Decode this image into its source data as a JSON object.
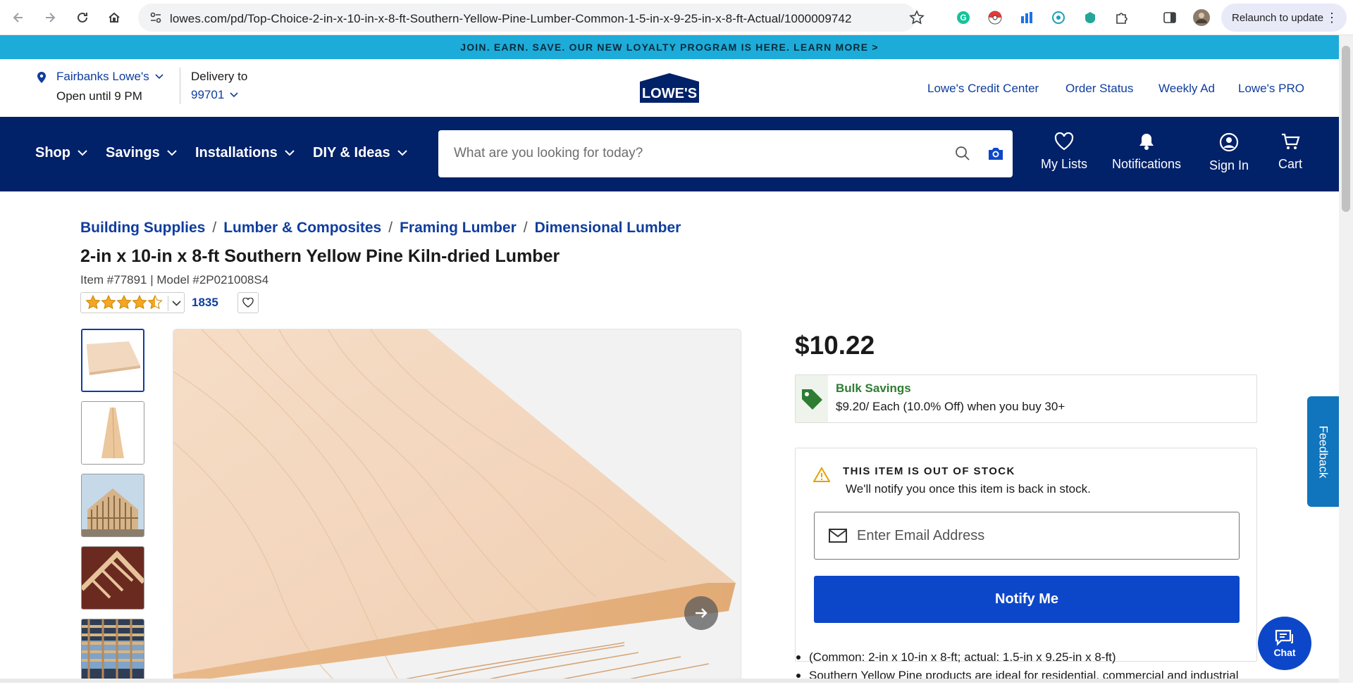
{
  "browser": {
    "url": "lowes.com/pd/Top-Choice-2-in-x-10-in-x-8-ft-Southern-Yellow-Pine-Lumber-Common-1-5-in-x-9-25-in-x-8-ft-Actual/1000009742",
    "relaunch_label": "Relaunch to update"
  },
  "promo": {
    "text": "JOIN. EARN. SAVE. OUR NEW LOYALTY PROGRAM IS HERE. LEARN MORE >"
  },
  "store": {
    "name": "Fairbanks Lowe's",
    "hours": "Open until 9 PM",
    "delivery_label": "Delivery to",
    "zip": "99701",
    "logo_text": "LOWE'S"
  },
  "top_links": [
    "Lowe's Credit Center",
    "Order Status",
    "Weekly Ad",
    "Lowe's PRO"
  ],
  "nav": {
    "items": [
      "Shop",
      "Savings",
      "Installations",
      "DIY & Ideas"
    ],
    "search_placeholder": "What are you looking for today?",
    "icons": [
      {
        "label": "My Lists",
        "icon": "heart-icon"
      },
      {
        "label": "Notifications",
        "icon": "bell-icon"
      },
      {
        "label": "Sign In",
        "icon": "user-icon"
      },
      {
        "label": "Cart",
        "icon": "cart-icon"
      }
    ]
  },
  "breadcrumb": [
    "Building Supplies",
    "Lumber & Composites",
    "Framing Lumber",
    "Dimensional Lumber"
  ],
  "product": {
    "title": "2-in x 10-in x 8-ft Southern Yellow Pine Kiln-dried Lumber",
    "item_line": "Item #77891 | Model #2P021008S4",
    "rating": 4.5,
    "review_count": "1835",
    "price": "$10.22"
  },
  "bulk": {
    "title": "Bulk Savings",
    "text": "$9.20/ Each (10.0% Off) when you buy 30+"
  },
  "stock": {
    "heading": "THIS ITEM IS OUT OF STOCK",
    "message": "We'll notify you once this item is back in stock.",
    "email_placeholder": "Enter Email Address",
    "notify_label": "Notify Me"
  },
  "specs": [
    "(Common: 2-in x 10-in x 8-ft; actual: 1.5-in x 9.25-in x 8-ft)",
    "Southern Yellow Pine products are ideal for residential, commercial and industrial"
  ],
  "feedback_label": "Feedback",
  "chat_label": "Chat",
  "colors": {
    "lowes_blue": "#012169",
    "cta_blue": "#0d47c9",
    "promo": "#1dacd9",
    "savings_green": "#2e7d32"
  }
}
